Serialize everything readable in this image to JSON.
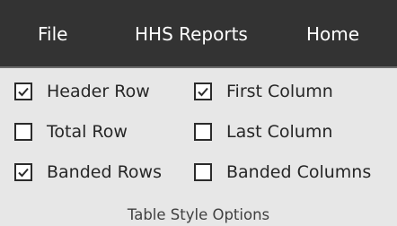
{
  "menu": {
    "tabs": [
      "File",
      "HHS Reports",
      "Home"
    ]
  },
  "table_style_options": {
    "group_label": "Table Style Options",
    "options": [
      {
        "label": "Header Row",
        "checked": true
      },
      {
        "label": "First Column",
        "checked": true
      },
      {
        "label": "Total Row",
        "checked": false
      },
      {
        "label": "Last Column",
        "checked": false
      },
      {
        "label": "Banded Rows",
        "checked": true
      },
      {
        "label": "Banded Columns",
        "checked": false
      }
    ]
  },
  "colors": {
    "tab_bar": "#333333",
    "panel": "#e7e7e7",
    "text": "#262626"
  }
}
